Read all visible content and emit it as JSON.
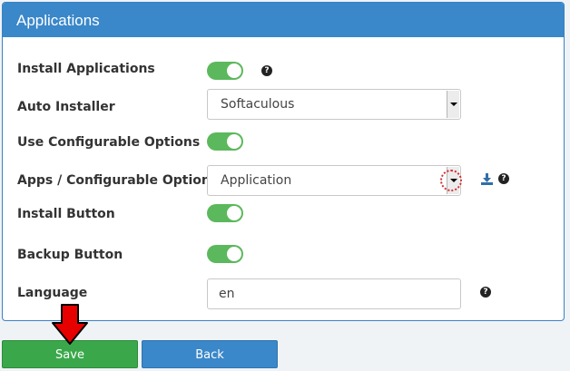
{
  "panel": {
    "title": "Applications"
  },
  "rows": {
    "install_applications": {
      "label": "Install Applications",
      "toggle_on": true
    },
    "auto_installer": {
      "label": "Auto Installer",
      "value": "Softaculous"
    },
    "use_configurable_options": {
      "label": "Use Configurable Options",
      "toggle_on": true
    },
    "apps_configurable_options": {
      "label": "Apps / Configurable Options",
      "value": "Application"
    },
    "install_button": {
      "label": "Install Button",
      "toggle_on": true
    },
    "backup_button": {
      "label": "Backup Button",
      "toggle_on": true
    },
    "language": {
      "label": "Language",
      "value": "en"
    }
  },
  "icons": {
    "help": "?",
    "download": "download-icon"
  },
  "buttons": {
    "save": "Save",
    "back": "Back"
  },
  "colors": {
    "header": "#3a87c9",
    "toggle_on": "#5cb85c",
    "save": "#3aa84a",
    "back": "#3a87c9",
    "annotation": "#e60000"
  }
}
